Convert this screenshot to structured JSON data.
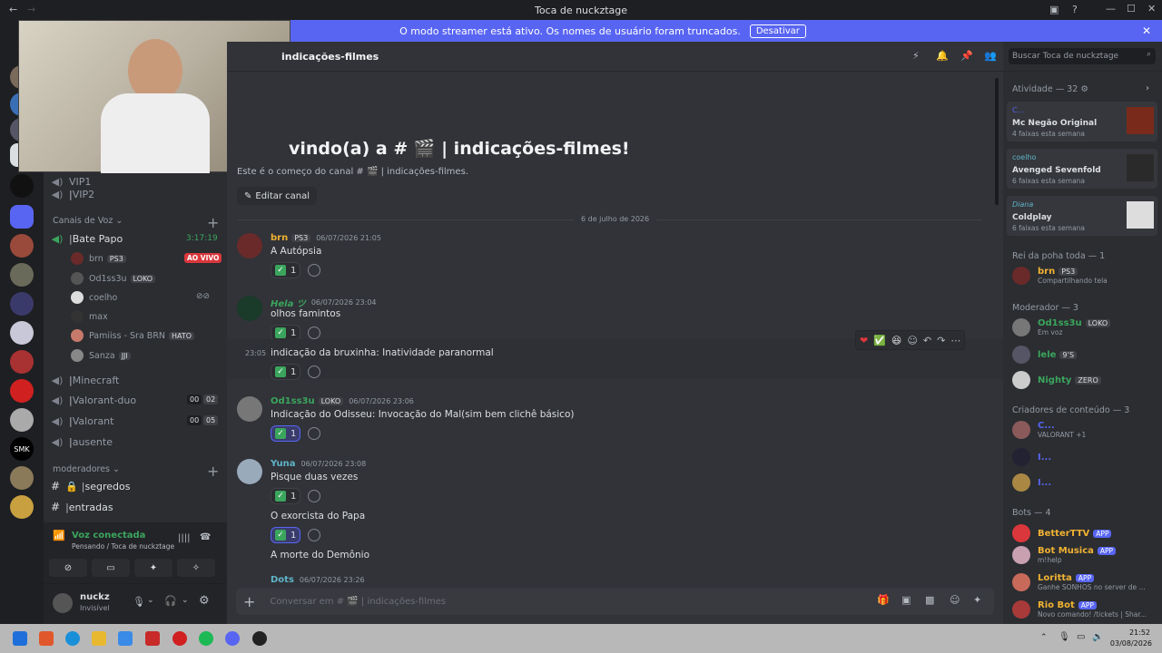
{
  "window": {
    "title": "Toca de nuckztage"
  },
  "streamer": {
    "text": "O modo streamer está ativo. Os nomes de usuário foram truncados.",
    "button": "Desativar"
  },
  "channels": {
    "top_items": [
      {
        "label": "VIP1"
      },
      {
        "label": "VIP2"
      }
    ],
    "voice_header": "Canais de Voz",
    "voice": [
      {
        "label": "Bate Papo",
        "timer": "3:17:19"
      },
      {
        "label": "Minecraft"
      },
      {
        "label": "Valorant-duo",
        "c1": "00",
        "c2": "02"
      },
      {
        "label": "Valorant",
        "c1": "00",
        "c2": "05"
      },
      {
        "label": "ausente"
      }
    ],
    "voice_users": [
      {
        "name": "brn",
        "tag": "PS3",
        "live": "AO VIVO"
      },
      {
        "name": "Od1ss3u",
        "tag": "LOKO"
      },
      {
        "name": "coelho"
      },
      {
        "name": "max"
      },
      {
        "name": "Pamiiss - Sra BRN",
        "tag": "HATO"
      },
      {
        "name": "Sanza",
        "tag": "JJI"
      }
    ],
    "mod_header": "moderadores",
    "mod_items": [
      {
        "label": "segredos"
      },
      {
        "label": "entradas"
      }
    ]
  },
  "voice_status": {
    "title": "Voz conectada",
    "sub": "Pensando / Toca de nuckztage"
  },
  "user": {
    "name": "nuckz",
    "status": "Invisível"
  },
  "main": {
    "channel_name": "indicações-filmes",
    "welcome_title": "vindo(a) a # 🎬 | indicações-filmes!",
    "welcome_sub": "Este é o começo do canal # 🎬 | indicações-filmes.",
    "edit_button": "Editar canal",
    "date_divider": "6 de julho de 2026",
    "input_placeholder": "Conversar em # 🎬 | indicações-filmes",
    "search_placeholder": "Buscar Toca de nuckztage"
  },
  "messages": [
    {
      "author": "brn",
      "tag": "PS3",
      "time": "06/07/2026 21:05",
      "text": "A Autópsia",
      "count": "1",
      "color": "#f0b232"
    },
    {
      "author": "Hela ツ",
      "time": "06/07/2026 23:04",
      "text": "olhos famintos",
      "count": "1",
      "color": "#3ba55d"
    },
    {
      "time": "23:05",
      "text": "indicação da bruxinha: Inatividade paranormal",
      "count": "1"
    },
    {
      "author": "Od1ss3u",
      "tag": "LOKO",
      "time": "06/07/2026 23:06",
      "text": "Indicação do Odisseu: Invocação do Mal(sim bem clichê básico)",
      "count": "1",
      "color": "#3ba55d"
    },
    {
      "author": "Yuna",
      "time": "06/07/2026 23:08",
      "text": "Pisque duas vezes",
      "count": "1",
      "color": "#5fb4c9"
    },
    {
      "text": "O exorcista do Papa",
      "count": "1"
    },
    {
      "text": "A morte do Demônio"
    },
    {
      "author": "Dots",
      "time": "06/07/2026 23:26",
      "color": "#5fb4c9"
    }
  ],
  "members": {
    "activity_header": "Atividade — 32",
    "activity": [
      {
        "user": "C...",
        "title": "Mc Negão Original",
        "sub": "4 faixas esta semana"
      },
      {
        "user": "coelho",
        "title": "Avenged Sevenfold",
        "sub": "6 faixas esta semana"
      },
      {
        "user": "Diana",
        "title": "Coldplay",
        "sub": "6 faixas esta semana"
      }
    ],
    "rei_header": "Rei da poha toda — 1",
    "rei": [
      {
        "name": "brn",
        "tag": "PS3",
        "sub": "Compartilhando tela"
      }
    ],
    "mod_header": "Moderador — 3",
    "mods": [
      {
        "name": "Od1ss3u",
        "tag": "LOKO",
        "sub": "Em voz"
      },
      {
        "name": "lele",
        "tag": "9ʼS"
      },
      {
        "name": "Nighty",
        "tag": "ZERO"
      }
    ],
    "creators_header": "Criadores de conteúdo — 3",
    "creators": [
      {
        "name": "C...",
        "sub": "VALORANT +1"
      },
      {
        "name": "I..."
      },
      {
        "name": "I..."
      }
    ],
    "bots_header": "Bots — 4",
    "bots": [
      {
        "name": "BetterTTV",
        "app": "APP"
      },
      {
        "name": "Bot Musica",
        "app": "APP",
        "sub": "m!help"
      },
      {
        "name": "Loritta",
        "app": "APP",
        "sub": "Ganhe SONHOS no server de ..."
      },
      {
        "name": "Rio Bot",
        "app": "APP",
        "sub": "Novo comando! /tickets | Shar..."
      }
    ]
  },
  "taskbar": {
    "time": "21:52",
    "date": "03/08/2026"
  }
}
